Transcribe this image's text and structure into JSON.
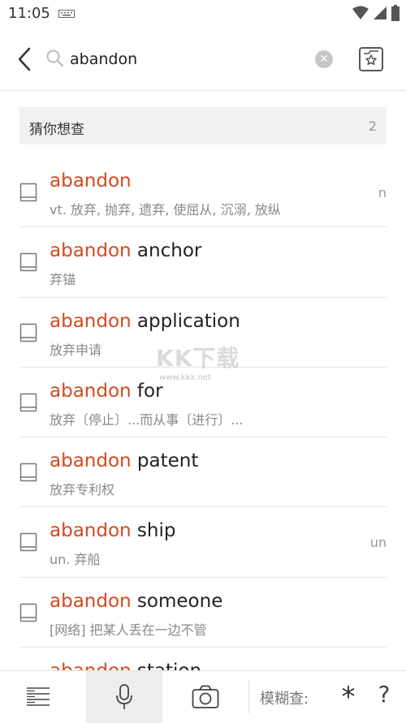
{
  "status": {
    "time": "11:05"
  },
  "search": {
    "query": "abandon",
    "placeholder": ""
  },
  "guess": {
    "label": "猜你想查",
    "count": "2"
  },
  "results": [
    {
      "match": "abandon",
      "rest": "",
      "def": "vt. 放弃, 抛弃, 遗弃, 使屈从, 沉溺, 放纵",
      "side": "n"
    },
    {
      "match": "abandon",
      "rest": " anchor",
      "def": "弃锚",
      "side": ""
    },
    {
      "match": "abandon",
      "rest": " application",
      "def": "放弃申请",
      "side": ""
    },
    {
      "match": "abandon",
      "rest": " for",
      "def": "放弃〔停止〕...而从事〔进行〕...",
      "side": ""
    },
    {
      "match": "abandon",
      "rest": " patent",
      "def": "放弃专利权",
      "side": ""
    },
    {
      "match": "abandon",
      "rest": " ship",
      "def": "un. 弃船",
      "side": "un"
    },
    {
      "match": "abandon",
      "rest": " someone",
      "def": "[网络] 把某人丢在一边不管",
      "side": ""
    },
    {
      "match": "abandon",
      "rest": " station",
      "def": "",
      "side": ""
    }
  ],
  "watermark": {
    "text": "KK下载",
    "url": "www.kkx.net"
  },
  "toolbar": {
    "fuzzy_label": "模糊查:",
    "wildcard": "*",
    "question": "?"
  },
  "colors": {
    "highlight": "#d24a1f",
    "text": "#222222",
    "muted": "#888888"
  },
  "icons": [
    "keyboard-icon",
    "wifi-icon",
    "signal-icon",
    "battery-icon",
    "back-icon",
    "search-icon",
    "clear-icon",
    "favorites-icon",
    "book-icon",
    "menu-icon",
    "microphone-icon",
    "camera-icon"
  ]
}
